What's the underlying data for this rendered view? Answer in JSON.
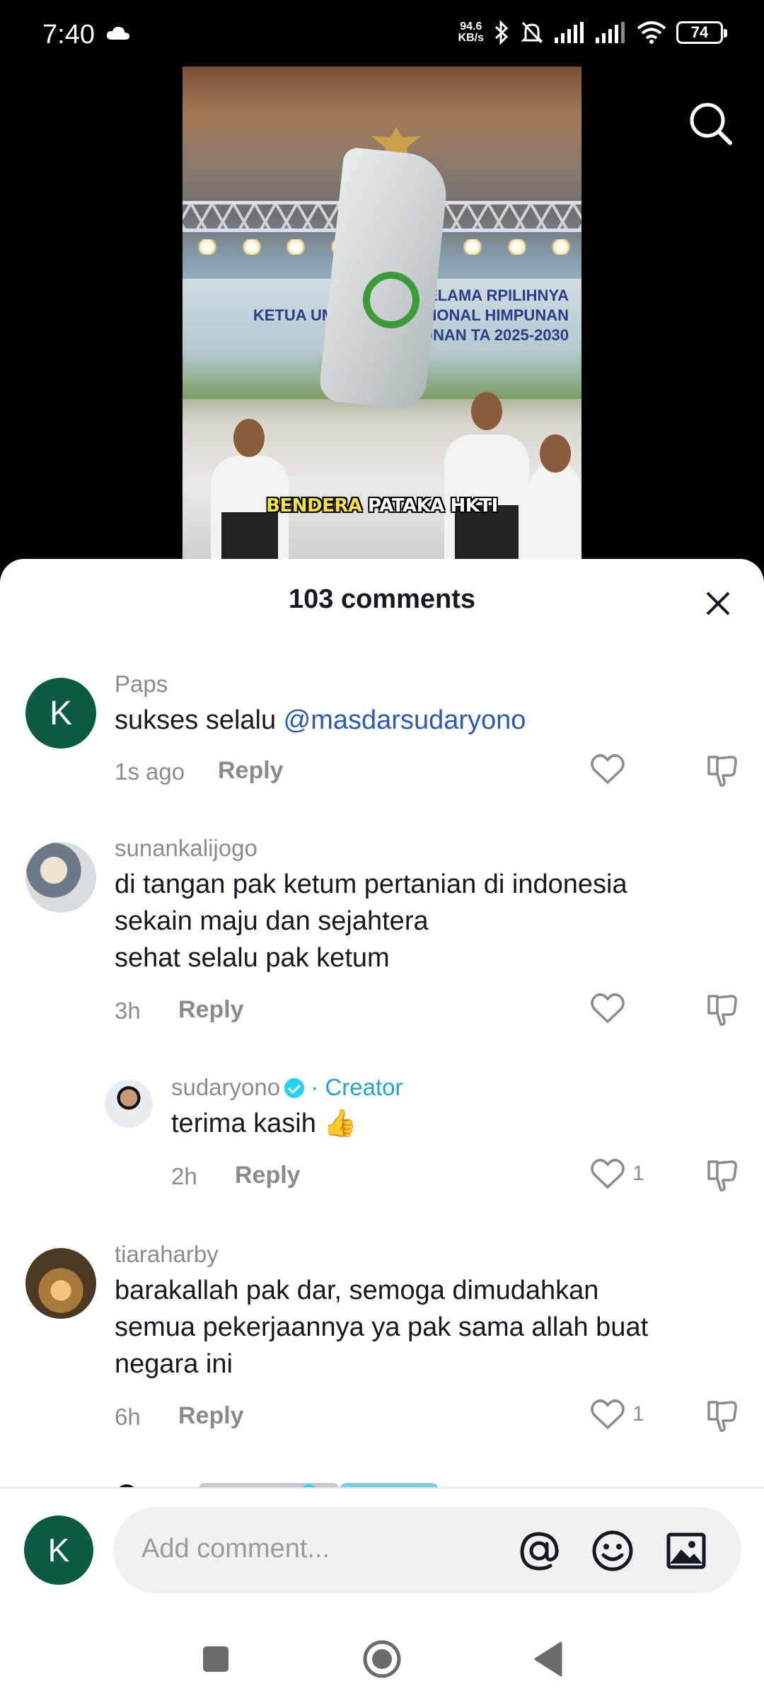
{
  "status_bar": {
    "time": "7:40",
    "net_speed_value": "94.6",
    "net_speed_unit": "KB/s",
    "battery": "74"
  },
  "video": {
    "banner_line1": "SELAMA RPILIHNYA",
    "banner_line2": "KETUA UMUM DEV NASIONAL HIMPUNAN",
    "banner_line3": "KERUKUNAN TA 2025-2030",
    "caption_highlight": "BENDERA",
    "caption_rest": " PATAKA HKTI"
  },
  "comments_sheet": {
    "title": "103 comments",
    "comments": [
      {
        "username": "Paps",
        "avatar_letter": "K",
        "text": "sukses selalu ",
        "mention": "@masdarsudaryono",
        "time": "1s ago",
        "reply_label": "Reply",
        "likes": ""
      },
      {
        "username": "sunankalijogo",
        "text": "di tangan pak ketum pertanian di indonesia\nsekain maju dan sejahtera\nsehat selalu pak ketum",
        "time": "3h",
        "reply_label": "Reply",
        "likes": ""
      },
      {
        "username": "sudaryono",
        "creator_label": "· Creator",
        "text": "terima kasih 👍",
        "time": "2h",
        "reply_label": "Reply",
        "likes": "1"
      },
      {
        "username": "tiaraharby",
        "text": "barakallah pak dar, semoga dimudahkan\nsemua pekerjaannya ya pak sama allah buat\nnegara ini",
        "time": "6h",
        "reply_label": "Reply",
        "likes": "1"
      }
    ]
  },
  "input": {
    "avatar_letter": "K",
    "placeholder": "Add comment..."
  },
  "colors": {
    "accent_mention": "#2a5bb8",
    "creator": "#1fa5c7",
    "avatar_bg": "#0a5a44"
  }
}
